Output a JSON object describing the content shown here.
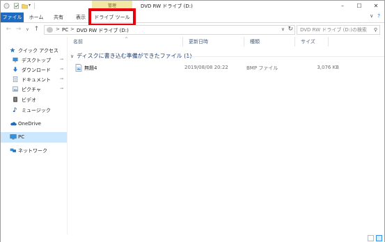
{
  "titlebar": {
    "title": "DVD RW ドライブ (D:)",
    "manage_tab": "管理",
    "controls": {
      "minimize": "–",
      "maximize": "☐",
      "close": "✕"
    }
  },
  "ribbon": {
    "tabs": [
      {
        "label": "ファイル"
      },
      {
        "label": "ホーム"
      },
      {
        "label": "共有"
      },
      {
        "label": "表示"
      },
      {
        "label": "ドライブ ツール"
      }
    ],
    "highlight_color": "#e8000d",
    "file_tab_color": "#1e6cc2"
  },
  "address": {
    "back": "←",
    "forward": "→",
    "recent": "∨",
    "up": "↑",
    "crumbs": [
      "PC",
      "DVD RW ドライブ (D:)"
    ],
    "separator": ">",
    "dropdown": "∨",
    "refresh": "↻",
    "search_placeholder": "DVD RW ドライブ (D:)の検索",
    "search_icon": "⚲"
  },
  "nav": {
    "items": [
      {
        "label": "クイック アクセス",
        "icon": "star-icon",
        "pinned": false
      },
      {
        "label": "デスクトップ",
        "icon": "desktop-icon",
        "pinned": true
      },
      {
        "label": "ダウンロード",
        "icon": "download-icon",
        "pinned": true
      },
      {
        "label": "ドキュメント",
        "icon": "document-icon",
        "pinned": true
      },
      {
        "label": "ピクチャ",
        "icon": "picture-icon",
        "pinned": true
      },
      {
        "label": "ビデオ",
        "icon": "video-icon",
        "pinned": false
      },
      {
        "label": "ミュージック",
        "icon": "music-icon",
        "pinned": false
      },
      {
        "label": "OneDrive",
        "icon": "cloud-icon",
        "pinned": false
      },
      {
        "label": "PC",
        "icon": "pc-icon",
        "pinned": false,
        "selected": true
      },
      {
        "label": "ネットワーク",
        "icon": "network-icon",
        "pinned": false
      }
    ],
    "pin_glyph": "📌"
  },
  "columns": {
    "name": "名前",
    "date": "更新日時",
    "type": "種類",
    "size": "サイズ"
  },
  "group": {
    "label": "ディスクに書き込む準備ができたファイル (1)",
    "chevron": "∨"
  },
  "files": [
    {
      "name": "無題4",
      "date": "2019/08/08 20:22",
      "type": "BMP ファイル",
      "size": "3,076 KB"
    }
  ]
}
